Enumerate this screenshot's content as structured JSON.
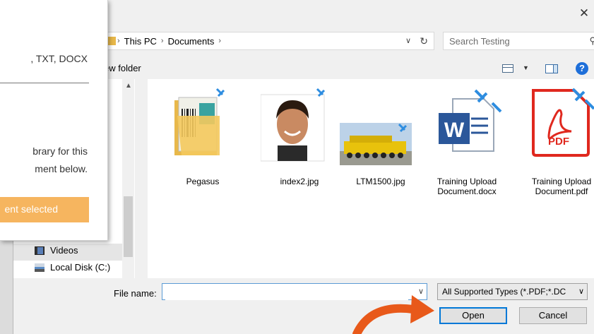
{
  "popup": {
    "formats_text": ", TXT, DOCX",
    "desc_line1": "brary for this",
    "desc_line2": "ment below.",
    "status_bar": "ent selected"
  },
  "dialog": {
    "close_label": "✕",
    "address": {
      "crumbs": [
        "This PC",
        "Documents"
      ],
      "separator": "›"
    },
    "search": {
      "placeholder": "Search Testing"
    },
    "toolbar": {
      "new_folder": "ew folder",
      "help": "?"
    },
    "nav_items": [
      {
        "label": "Videos",
        "icon": "videos-icon"
      },
      {
        "label": "Local Disk (C:)",
        "icon": "local-disk-icon"
      }
    ],
    "files": [
      {
        "name": "Pegasus",
        "type": "folder"
      },
      {
        "name": "index2.jpg",
        "type": "image-portrait"
      },
      {
        "name": "LTM1500.jpg",
        "type": "image-crane"
      },
      {
        "name_line1": "Training Upload",
        "name_line2": "Document.docx",
        "type": "word"
      },
      {
        "name_line1": "Training Upload",
        "name_line2": "Document.pdf",
        "type": "pdf",
        "badge": "PDF"
      }
    ],
    "footer": {
      "file_name_label": "File name:",
      "file_name_value": "",
      "file_type": "All Supported Types (*.PDF;*.DC",
      "open_label": "Open",
      "cancel_label": "Cancel"
    }
  },
  "colors": {
    "accent": "#0078d7",
    "status_orange": "#f6b55f",
    "arrow_orange": "#e8591a",
    "pdf_red": "#e0281e",
    "word_blue": "#2b579a"
  }
}
